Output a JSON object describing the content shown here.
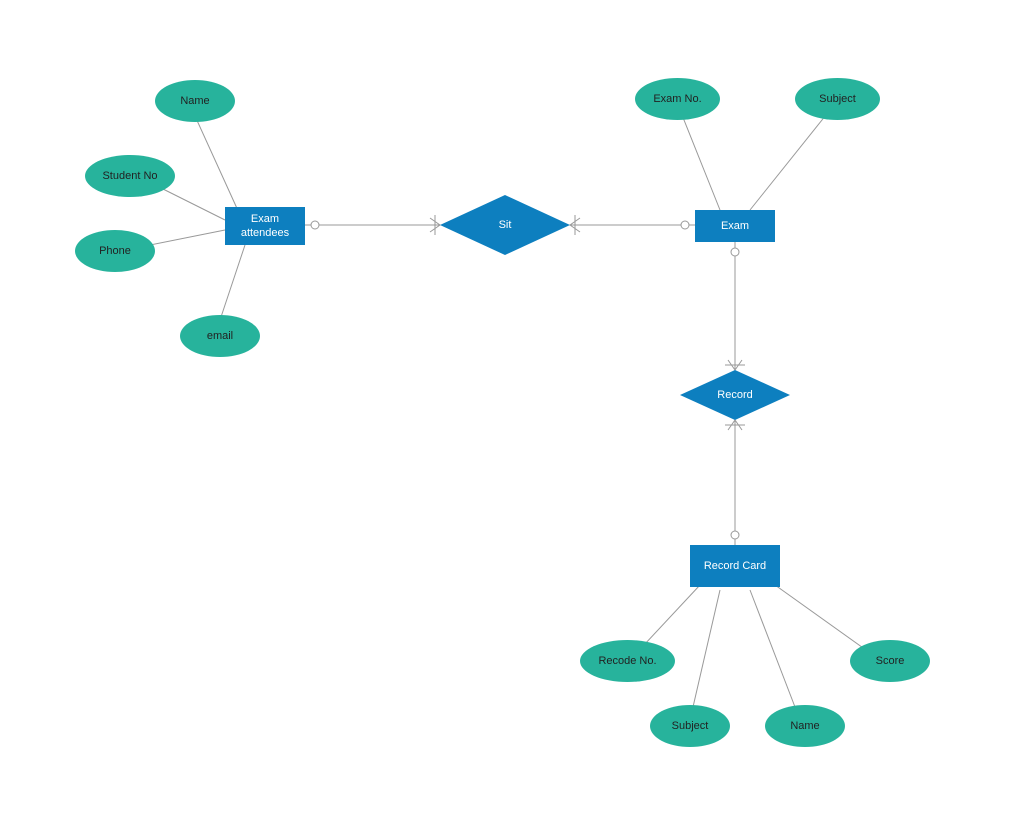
{
  "entities": {
    "examAttendees": "Exam\nattendees",
    "exam": "Exam",
    "recordCard": "Record Card"
  },
  "relationships": {
    "sit": "Sit",
    "record": "Record"
  },
  "attributes": {
    "name": "Name",
    "studentNo": "Student No",
    "phone": "Phone",
    "email": "email",
    "examNo": "Exam No.",
    "subject": "Subject",
    "recodeNo": "Recode No.",
    "subject2": "Subject",
    "name2": "Name",
    "score": "Score"
  }
}
